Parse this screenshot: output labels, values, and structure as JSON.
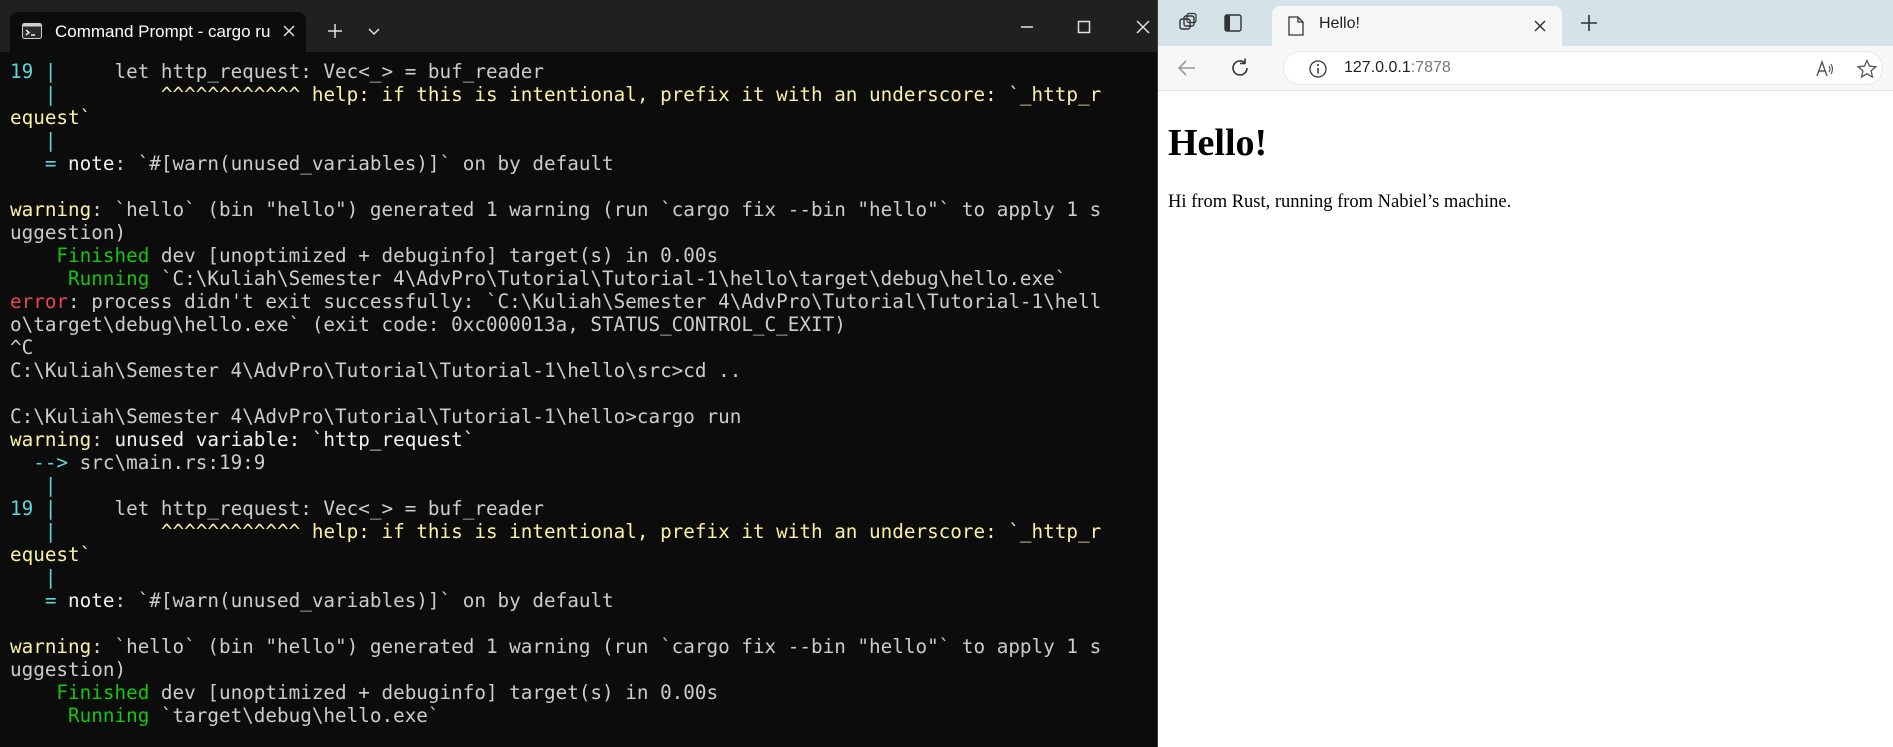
{
  "terminal": {
    "tab_title": "Command Prompt - cargo  ru",
    "lines": [
      [
        {
          "t": "19 |     ",
          "c": "cy"
        },
        {
          "t": "let http_request: Vec<_> = buf_reader",
          "c": ""
        }
      ],
      [
        {
          "t": "   |         ",
          "c": "cy"
        },
        {
          "t": "^^^^^^^^^^^^ help: if this is intentional, prefix it with an underscore: `_http_r",
          "c": "yl"
        }
      ],
      [
        {
          "t": "equest`",
          "c": "yl"
        }
      ],
      [
        {
          "t": "   |",
          "c": "cy"
        }
      ],
      [
        {
          "t": "   = ",
          "c": "cy"
        },
        {
          "t": "note",
          "c": "wh"
        },
        {
          "t": ": `#[warn(unused_variables)]` on by default",
          "c": ""
        }
      ],
      [
        {
          "t": "",
          "c": ""
        }
      ],
      [
        {
          "t": "warning",
          "c": "yl"
        },
        {
          "t": ": `hello` (bin \"hello\") generated 1 warning (run `cargo fix --bin \"hello\"` to apply 1 s",
          "c": ""
        }
      ],
      [
        {
          "t": "uggestion)",
          "c": ""
        }
      ],
      [
        {
          "t": "    Finished",
          "c": "gr"
        },
        {
          "t": " dev [unoptimized + debuginfo] target(s) in 0.00s",
          "c": ""
        }
      ],
      [
        {
          "t": "     Running",
          "c": "gr"
        },
        {
          "t": " `C:\\Kuliah\\Semester 4\\AdvPro\\Tutorial\\Tutorial-1\\hello\\target\\debug\\hello.exe`",
          "c": ""
        }
      ],
      [
        {
          "t": "error",
          "c": "rd"
        },
        {
          "t": ": process didn't exit successfully: `C:\\Kuliah\\Semester 4\\AdvPro\\Tutorial\\Tutorial-1\\hell",
          "c": ""
        }
      ],
      [
        {
          "t": "o\\target\\debug\\hello.exe` (exit code: 0xc000013a, STATUS_CONTROL_C_EXIT)",
          "c": ""
        }
      ],
      [
        {
          "t": "^C",
          "c": ""
        }
      ],
      [
        {
          "t": "C:\\Kuliah\\Semester 4\\AdvPro\\Tutorial\\Tutorial-1\\hello\\src>cd ..",
          "c": ""
        }
      ],
      [
        {
          "t": "",
          "c": ""
        }
      ],
      [
        {
          "t": "C:\\Kuliah\\Semester 4\\AdvPro\\Tutorial\\Tutorial-1\\hello>cargo run",
          "c": ""
        }
      ],
      [
        {
          "t": "warning",
          "c": "yl"
        },
        {
          "t": ": ",
          "c": ""
        },
        {
          "t": "unused variable: `http_request`",
          "c": "wh"
        }
      ],
      [
        {
          "t": "  --> ",
          "c": "cy"
        },
        {
          "t": "src\\main.rs:19:9",
          "c": ""
        }
      ],
      [
        {
          "t": "   |",
          "c": "cy"
        }
      ],
      [
        {
          "t": "19 |     ",
          "c": "cy"
        },
        {
          "t": "let http_request: Vec<_> = buf_reader",
          "c": ""
        }
      ],
      [
        {
          "t": "   |         ",
          "c": "cy"
        },
        {
          "t": "^^^^^^^^^^^^ help: if this is intentional, prefix it with an underscore: `_http_r",
          "c": "yl"
        }
      ],
      [
        {
          "t": "equest`",
          "c": "yl"
        }
      ],
      [
        {
          "t": "   |",
          "c": "cy"
        }
      ],
      [
        {
          "t": "   = ",
          "c": "cy"
        },
        {
          "t": "note",
          "c": "wh"
        },
        {
          "t": ": `#[warn(unused_variables)]` on by default",
          "c": ""
        }
      ],
      [
        {
          "t": "",
          "c": ""
        }
      ],
      [
        {
          "t": "warning",
          "c": "yl"
        },
        {
          "t": ": `hello` (bin \"hello\") generated 1 warning (run `cargo fix --bin \"hello\"` to apply 1 s",
          "c": ""
        }
      ],
      [
        {
          "t": "uggestion)",
          "c": ""
        }
      ],
      [
        {
          "t": "    Finished",
          "c": "gr"
        },
        {
          "t": " dev [unoptimized + debuginfo] target(s) in 0.00s",
          "c": ""
        }
      ],
      [
        {
          "t": "     Running",
          "c": "gr"
        },
        {
          "t": " `target\\debug\\hello.exe`",
          "c": ""
        }
      ]
    ]
  },
  "browser": {
    "tab_title": "Hello!",
    "url_host": "127.0.0.1",
    "url_port": ":7878",
    "page": {
      "heading": "Hello!",
      "paragraph": "Hi from Rust, running from Nabiel’s machine."
    }
  },
  "icons": {
    "terminal_app": "terminal-icon",
    "close": "close-icon",
    "add": "plus-icon",
    "dropdown": "chevron-down-icon",
    "minimize": "minimize-icon",
    "maximize": "maximize-icon",
    "workspaces": "workspaces-icon",
    "tab_actions": "tab-actions-icon",
    "page": "page-icon",
    "back": "back-arrow-icon",
    "refresh": "refresh-icon",
    "info": "info-icon",
    "read_aloud": "read-aloud-icon",
    "favorite": "star-icon"
  },
  "colors": {
    "terminal_bg": "#0c0c0c",
    "terminal_titlebar": "#202020",
    "cyan": "#61d6d6",
    "yellow": "#f9f1a5",
    "green": "#16c60c",
    "red": "#e74856",
    "browser_tabstrip": "#d3e3e8"
  }
}
